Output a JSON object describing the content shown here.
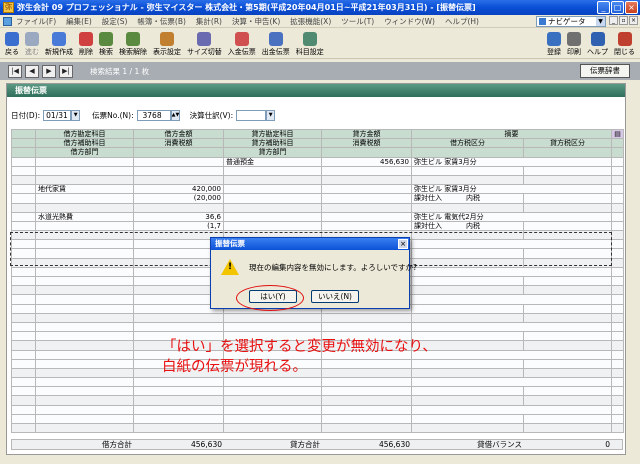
{
  "window": {
    "title": "弥生会計 09 プロフェッショナル - 弥生マイスター 株式会社・第5期(平成20年04月01日~平成21年03月31日) - [振替伝票]",
    "controls": [
      "_",
      "□",
      "×"
    ]
  },
  "menubar": {
    "items": [
      "ファイル(F)",
      "編集(E)",
      "設定(S)",
      "帳簿・伝票(B)",
      "集計(R)",
      "決算・申告(K)",
      "拡張機能(X)",
      "ツール(T)",
      "ウィンドウ(W)",
      "ヘルプ(H)"
    ],
    "navigator_label": "ナビゲータ"
  },
  "toolbar": {
    "left": [
      {
        "label": "戻る",
        "icon": "back-arrow-icon",
        "color": "#3a6fd0",
        "disabled": false
      },
      {
        "label": "進む",
        "icon": "forward-arrow-icon",
        "color": "#9aa8c0",
        "disabled": true
      },
      {
        "label": "新規作成",
        "icon": "new-document-icon",
        "color": "#4a7ad8",
        "disabled": false
      },
      {
        "label": "削除",
        "icon": "delete-icon",
        "color": "#d04040",
        "disabled": false
      },
      {
        "label": "検索",
        "icon": "search-icon",
        "color": "#5a8a40",
        "disabled": false
      },
      {
        "label": "検索解除",
        "icon": "search-clear-icon",
        "color": "#5a8a40",
        "disabled": false
      },
      {
        "label": "表示設定",
        "icon": "display-settings-icon",
        "color": "#c08030",
        "disabled": false
      },
      {
        "label": "サイズ切替",
        "icon": "resize-icon",
        "color": "#6a6ab0",
        "disabled": false
      },
      {
        "label": "入金伝票",
        "icon": "deposit-slip-icon",
        "color": "#d05050",
        "disabled": false
      },
      {
        "label": "出金伝票",
        "icon": "withdrawal-slip-icon",
        "color": "#4a70c0",
        "disabled": false
      },
      {
        "label": "科目設定",
        "icon": "account-settings-icon",
        "color": "#508a70",
        "disabled": false
      }
    ],
    "right": [
      {
        "label": "登録",
        "icon": "register-icon",
        "color": "#3a70c0"
      },
      {
        "label": "印刷",
        "icon": "print-icon",
        "color": "#707070"
      },
      {
        "label": "ヘルプ",
        "icon": "help-icon",
        "color": "#3060b0"
      },
      {
        "label": "閉じる",
        "icon": "close-door-icon",
        "color": "#c04030"
      }
    ]
  },
  "nav": {
    "arrows": [
      "|◀",
      "◀",
      "▶",
      "▶|"
    ],
    "result_text": "検索結果 1 / 1 枚",
    "dict_button": "伝票辞書"
  },
  "form": {
    "title": "振替伝票",
    "date_label": "日付(D):",
    "date_value": "01/31",
    "slip_no_label": "伝票No.(N):",
    "slip_no_value": "3768",
    "settlement_label": "決算仕訳(V):",
    "settlement_value": ""
  },
  "grid": {
    "header_row1": [
      "借方勘定科目",
      "借方金額",
      "貸方勘定科目",
      "貸方金額",
      "摘要"
    ],
    "header_row2": [
      "借方補助科目",
      "消費税額",
      "貸方補助科目",
      "消費税額",
      "借方税区分",
      "貸方税区分"
    ],
    "header_row3": [
      "借方部門",
      "貸方部門"
    ],
    "entries": [
      {
        "debit_account": "",
        "debit_amount": "",
        "credit_account": "普通預金",
        "credit_amount": "456,630",
        "memo": "弥生ビル 家賃3月分",
        "debit_sub": "",
        "debit_tax": "",
        "credit_sub": "",
        "credit_tax": "",
        "debit_tax_class": "",
        "credit_tax_class": ""
      },
      {
        "debit_account": "地代家賃",
        "debit_amount": "420,000",
        "credit_account": "",
        "credit_amount": "",
        "memo": "弥生ビル 家賃3月分",
        "debit_sub": "",
        "debit_tax": "(20,000",
        "credit_sub": "",
        "credit_tax": "",
        "debit_tax_class": "課対仕入",
        "debit_tax_class2": "内税",
        "credit_tax_class": ""
      },
      {
        "debit_account": "水道光熱費",
        "debit_amount": "36,6",
        "credit_account": "",
        "credit_amount": "",
        "memo": "弥生ビル 電気代2月分",
        "debit_sub": "",
        "debit_tax": "(1,7",
        "credit_sub": "",
        "credit_tax": "",
        "debit_tax_class": "課対仕入",
        "debit_tax_class2": "内税",
        "credit_tax_class": ""
      }
    ]
  },
  "totals": {
    "debit_label": "借方合計",
    "debit_total": "456,630",
    "credit_label": "貸方合計",
    "credit_total": "456,630",
    "balance_label": "貸借バランス",
    "balance_value": "0"
  },
  "dialog": {
    "title": "振替伝票",
    "message": "現在の編集内容を無効にします。よろしいですか?",
    "yes_label": "はい(Y)",
    "no_label": "いいえ(N)"
  },
  "annotation": {
    "line1": "「はい」を選択すると変更が無効になり、",
    "line2": "白紙の伝票が現れる。",
    "color": "#e81010"
  }
}
